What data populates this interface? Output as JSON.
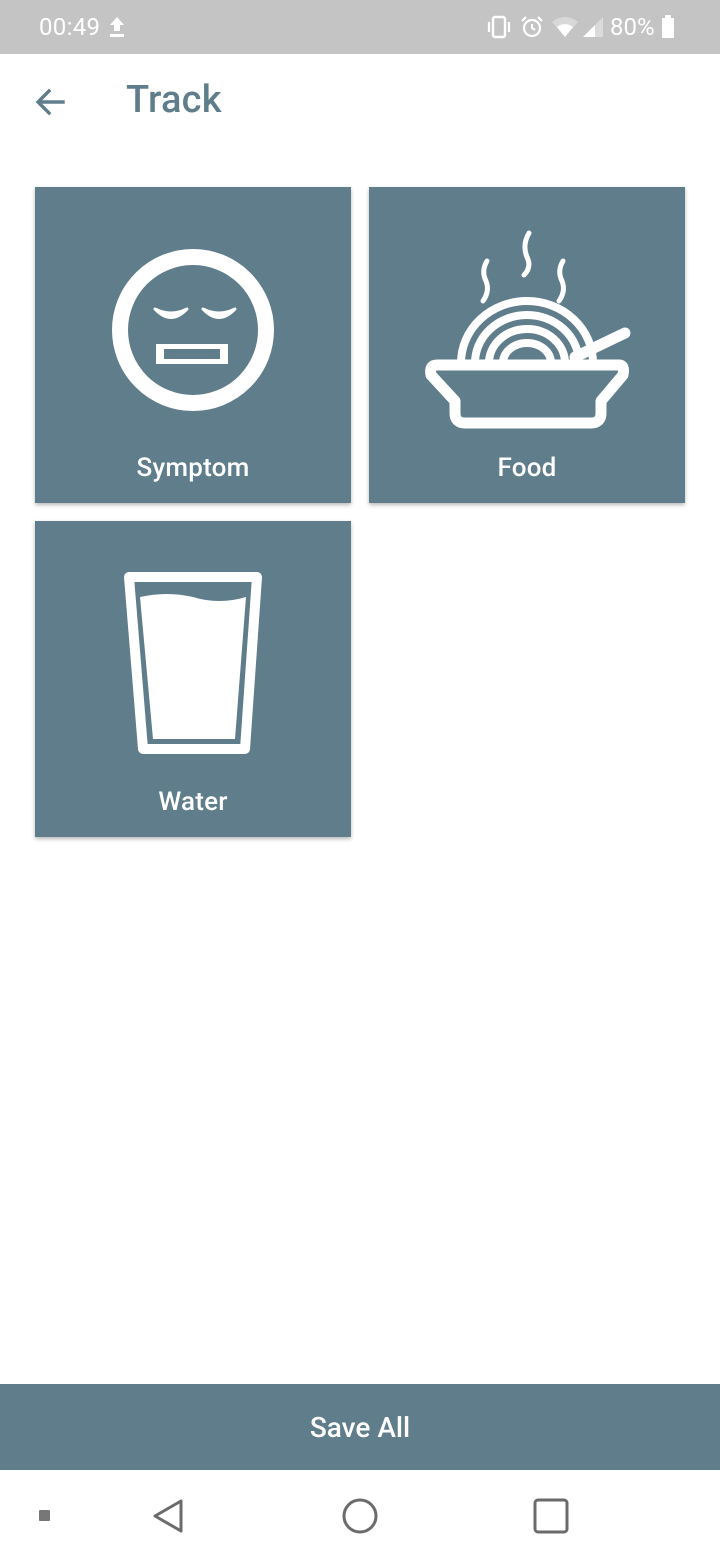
{
  "status_bar": {
    "time": "00:49",
    "battery_percent": "80%",
    "icons": [
      "upload-icon",
      "vibrate-icon",
      "alarm-icon",
      "wifi-icon",
      "signal-icon",
      "battery-icon"
    ]
  },
  "app_bar": {
    "title": "Track",
    "back_icon": "arrow-back-icon"
  },
  "tiles": [
    {
      "label": "Symptom",
      "icon": "unwell-face-icon"
    },
    {
      "label": "Food",
      "icon": "bowl-of-noodles-icon"
    },
    {
      "label": "Water",
      "icon": "glass-of-water-icon"
    }
  ],
  "save_bar": {
    "label": "Save All"
  },
  "nav_bar": {
    "icons": [
      "small-square-icon",
      "back-triangle-icon",
      "home-circle-icon",
      "recents-square-icon"
    ]
  },
  "colors": {
    "accent": "#607d8b",
    "status_bar": "#c4c4c4",
    "background": "#ffffff",
    "tile_text": "#ffffff"
  }
}
